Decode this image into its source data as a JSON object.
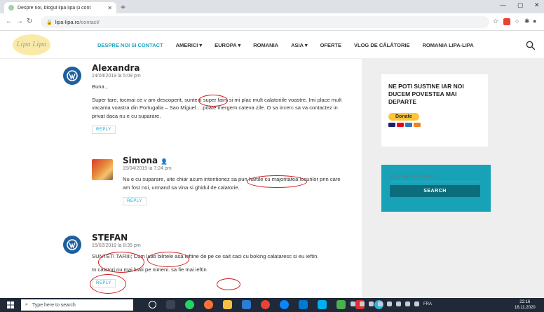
{
  "browser": {
    "tab_title": "Despre noi, blogul lipa lipa și cont",
    "url_host": "lipa-lipa.ro",
    "url_path": "/contact/"
  },
  "site": {
    "logo_text": "Lipa Lipa",
    "nav": [
      {
        "label": "DESPRE NOI SI CONTACT",
        "active": true
      },
      {
        "label": "AMERICI ▾"
      },
      {
        "label": "EUROPA ▾"
      },
      {
        "label": "ROMANIA"
      },
      {
        "label": "ASIA ▾"
      },
      {
        "label": "OFERTE"
      },
      {
        "label": "VLOG DE CĂLĂTORIE"
      },
      {
        "label": "ROMANIA LIPA-LIPA"
      }
    ]
  },
  "comments": [
    {
      "name": "Alexandra",
      "date": "14/04/2019 la 5:09 pm",
      "greeting": "Buna ,",
      "text": "Super tare, tocmai ce v am descoperit, sunte ti super faini si mi plac mult calatoriile voastre. Imi place mult vacanta voastra din Portugalia – Sao Miguel….poate mergem cateva zile. O sa incerc sa va contactez in privat daca nu e cu suparare.",
      "reply": "REPLY"
    },
    {
      "name": "Simona",
      "author_badge": "👤",
      "date": "15/04/2019 la 7:24 pm",
      "text": "Nu e cu suparare, uite chiar acum intentionez sa pun hartile cu majoritatea locurilor prin care am fost noi, urmand sa vina si ghidul de calatorie.",
      "reply": "REPLY"
    },
    {
      "name": "STEFAN",
      "date": "15/02/2019 la 8:35 pm",
      "text1": "SUNTETI TARIII; Cum luati bilrtele asa ieftine de pe ce sait caci cu boking calataresc si eu ieftin.",
      "text2": "In calatori nu mai luati pe nimeni. sa fie mai ieftin",
      "reply": "REPLY"
    }
  ],
  "sidebar": {
    "donate_title": "NE POTI SUSTINE IAR NOI DUCEM POVESTEA MAI DEPARTE",
    "donate_label": "Donate",
    "search_placeholder": "Type here to search...",
    "search_button": "SEARCH"
  },
  "taskbar": {
    "search_placeholder": "Type here to search",
    "lang": "FRA",
    "time": "22:16",
    "date": "16.11.2020"
  },
  "colors": {
    "accent": "#1da5c4",
    "annotation_ring": "#d21d1d",
    "search_widget": "#18a2b8"
  }
}
